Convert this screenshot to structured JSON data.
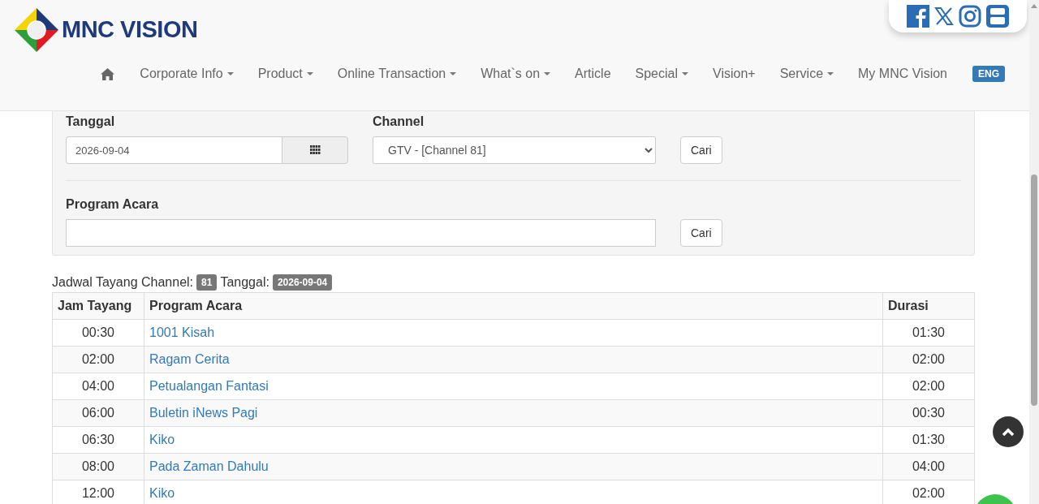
{
  "header": {
    "logo_text": "MNC VISION",
    "nav": [
      {
        "label": "Corporate Info",
        "dropdown": true
      },
      {
        "label": "Product",
        "dropdown": true
      },
      {
        "label": "Online Transaction",
        "dropdown": true
      },
      {
        "label": "What`s on",
        "dropdown": true
      },
      {
        "label": "Article",
        "dropdown": false
      },
      {
        "label": "Special",
        "dropdown": true
      },
      {
        "label": "Vision+",
        "dropdown": false
      },
      {
        "label": "Service",
        "dropdown": true
      },
      {
        "label": "My MNC Vision",
        "dropdown": false
      }
    ],
    "language": "ENG"
  },
  "search": {
    "date_label": "Tanggal",
    "date_value": "2026-09-04",
    "channel_label": "Channel",
    "channel_value": "GTV - [Channel 81]",
    "search_button": "Cari",
    "program_label": "Program Acara",
    "program_button": "Cari"
  },
  "schedule": {
    "caption": "Jadwal Tayang Channel:",
    "channel": "81",
    "date_caption": "Tanggal:",
    "date": "2026-09-04",
    "columns": [
      "Jam Tayang",
      "Program Acara",
      "Durasi"
    ],
    "rows": [
      {
        "time": "00:30",
        "program": "1001 Kisah",
        "duration": "01:30"
      },
      {
        "time": "02:00",
        "program": "Ragam Cerita",
        "duration": "02:00"
      },
      {
        "time": "04:00",
        "program": "Petualangan Fantasi",
        "duration": "02:00"
      },
      {
        "time": "06:00",
        "program": "Buletin iNews Pagi",
        "duration": "00:30"
      },
      {
        "time": "06:30",
        "program": "Kiko",
        "duration": "01:30"
      },
      {
        "time": "08:00",
        "program": "Pada Zaman Dahulu",
        "duration": "04:00"
      },
      {
        "time": "12:00",
        "program": "Kiko",
        "duration": "02:00"
      }
    ]
  }
}
